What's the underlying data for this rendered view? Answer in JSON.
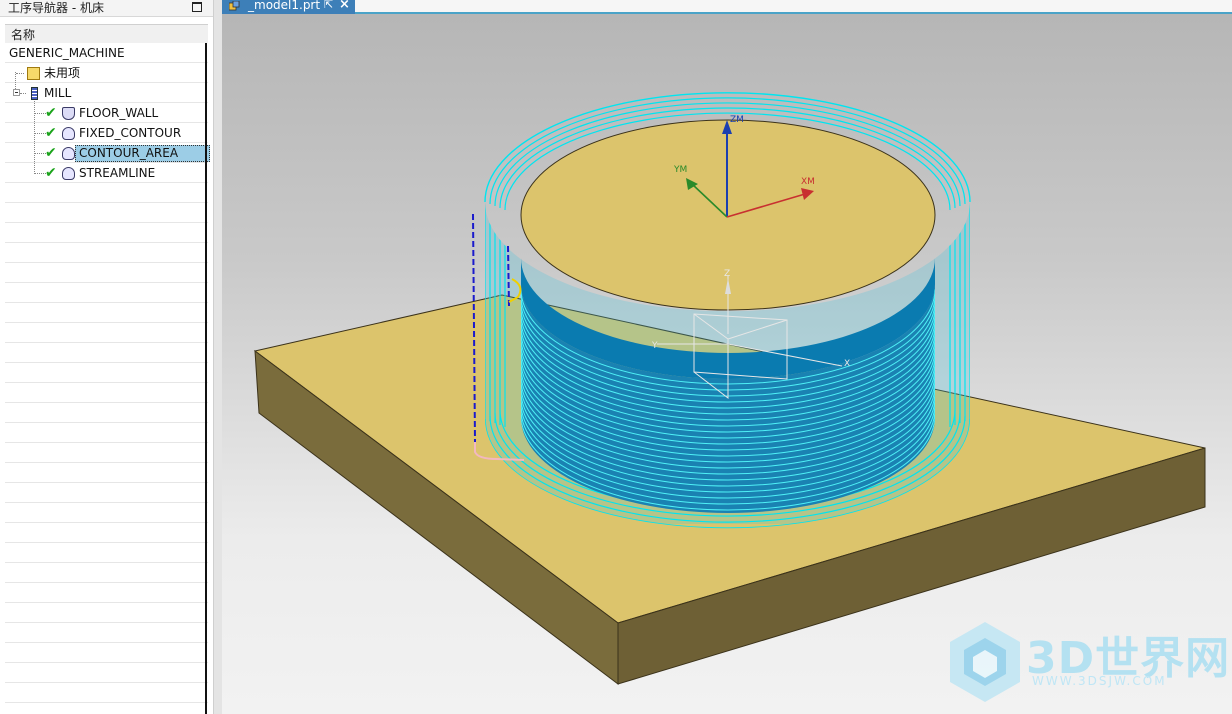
{
  "navigator": {
    "title": "工序导航器 - 机床",
    "column_header": "名称",
    "root": "GENERIC_MACHINE",
    "unused": "未用项",
    "group": "MILL",
    "operations": [
      {
        "label": "FLOOR_WALL",
        "icon": "floor-wall-op-icon"
      },
      {
        "label": "FIXED_CONTOUR",
        "icon": "contour-op-icon"
      },
      {
        "label": "CONTOUR_AREA",
        "icon": "contour-op-icon",
        "selected": true
      },
      {
        "label": "STREAMLINE",
        "icon": "contour-op-icon"
      }
    ]
  },
  "tab": {
    "file": "_model1.prt",
    "popout_icon": "popout-icon",
    "close_icon": "close-icon"
  },
  "axes": {
    "zm": "ZM",
    "ym": "YM",
    "xm": "XM",
    "z": "Z",
    "y": "Y",
    "x": "X"
  },
  "watermark": {
    "main": "3D世界网",
    "sub": "WWW.3DSJW.COM"
  },
  "colors": {
    "toolpath": "#00e5f0",
    "part_top": "#dcc46c",
    "part_side": "#7b6a3a",
    "cylinder_band": "#0a7bb0",
    "selection": "#9ccde6",
    "tab": "#3d7fb8"
  }
}
